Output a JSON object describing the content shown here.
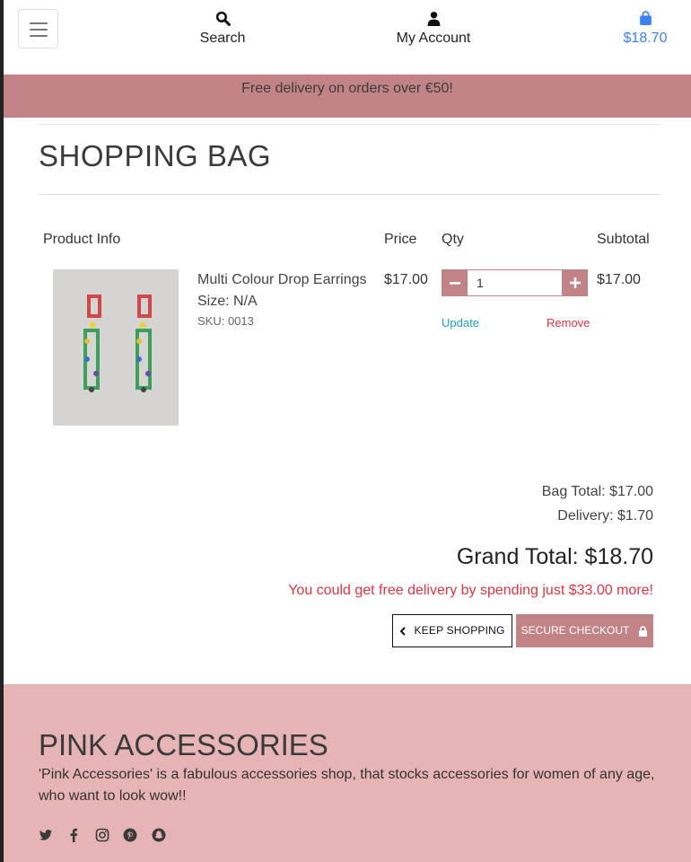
{
  "header": {
    "search_label": "Search",
    "account_label": "My Account",
    "bag_total": "$18.70",
    "accent_color": "#3b82f6"
  },
  "banner": {
    "text": "Free delivery on orders over €50!",
    "color": "#c28387"
  },
  "page": {
    "title": "SHOPPING BAG"
  },
  "table": {
    "headers": {
      "product_info": "Product Info",
      "price": "Price",
      "qty": "Qty",
      "subtotal": "Subtotal"
    },
    "items": [
      {
        "name": "Multi Colour Drop Earrings",
        "size": "Size: N/A",
        "sku": "SKU: 0013",
        "price": "$17.00",
        "quantity": "1",
        "subtotal": "$17.00",
        "update_label": "Update",
        "remove_label": "Remove"
      }
    ]
  },
  "totals": {
    "bag_total": "Bag Total: $17.00",
    "delivery": "Delivery: $1.70",
    "grand_total": "Grand Total: $18.70",
    "free_delivery_msg": "You could get free delivery by spending just $33.00 more!"
  },
  "buttons": {
    "keep_shopping": "KEEP SHOPPING",
    "secure_checkout": "SECURE CHECKOUT"
  },
  "footer": {
    "title": "PINK ACCESSORIES",
    "text": "'Pink Accessories' is a fabulous accessories shop, that stocks accessories for women of any age, who want to look wow!!",
    "social_icons": [
      "twitter-icon",
      "facebook-icon",
      "instagram-icon",
      "pinterest-icon",
      "snapchat-icon"
    ],
    "background": "#e6b4b5"
  }
}
